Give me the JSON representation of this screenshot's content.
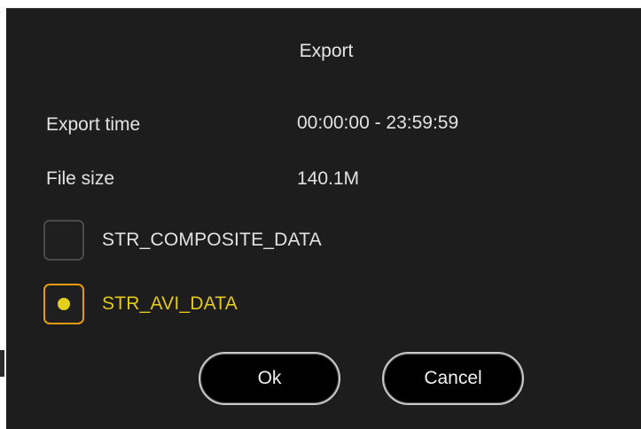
{
  "dialog": {
    "title": "Export",
    "export_time_label": "Export time",
    "export_time_value": "00:00:00 - 23:59:59",
    "file_size_label": "File size",
    "file_size_value": "140.1M"
  },
  "options": [
    {
      "label": "STR_COMPOSITE_DATA",
      "selected": false
    },
    {
      "label": "STR_AVI_DATA",
      "selected": true
    }
  ],
  "buttons": {
    "ok_label": "Ok",
    "cancel_label": "Cancel"
  },
  "colors": {
    "background": "#1d1d1d",
    "selected_border": "#e49a12",
    "selected_text": "#e5c81c",
    "button_border": "#c9c9c9"
  }
}
